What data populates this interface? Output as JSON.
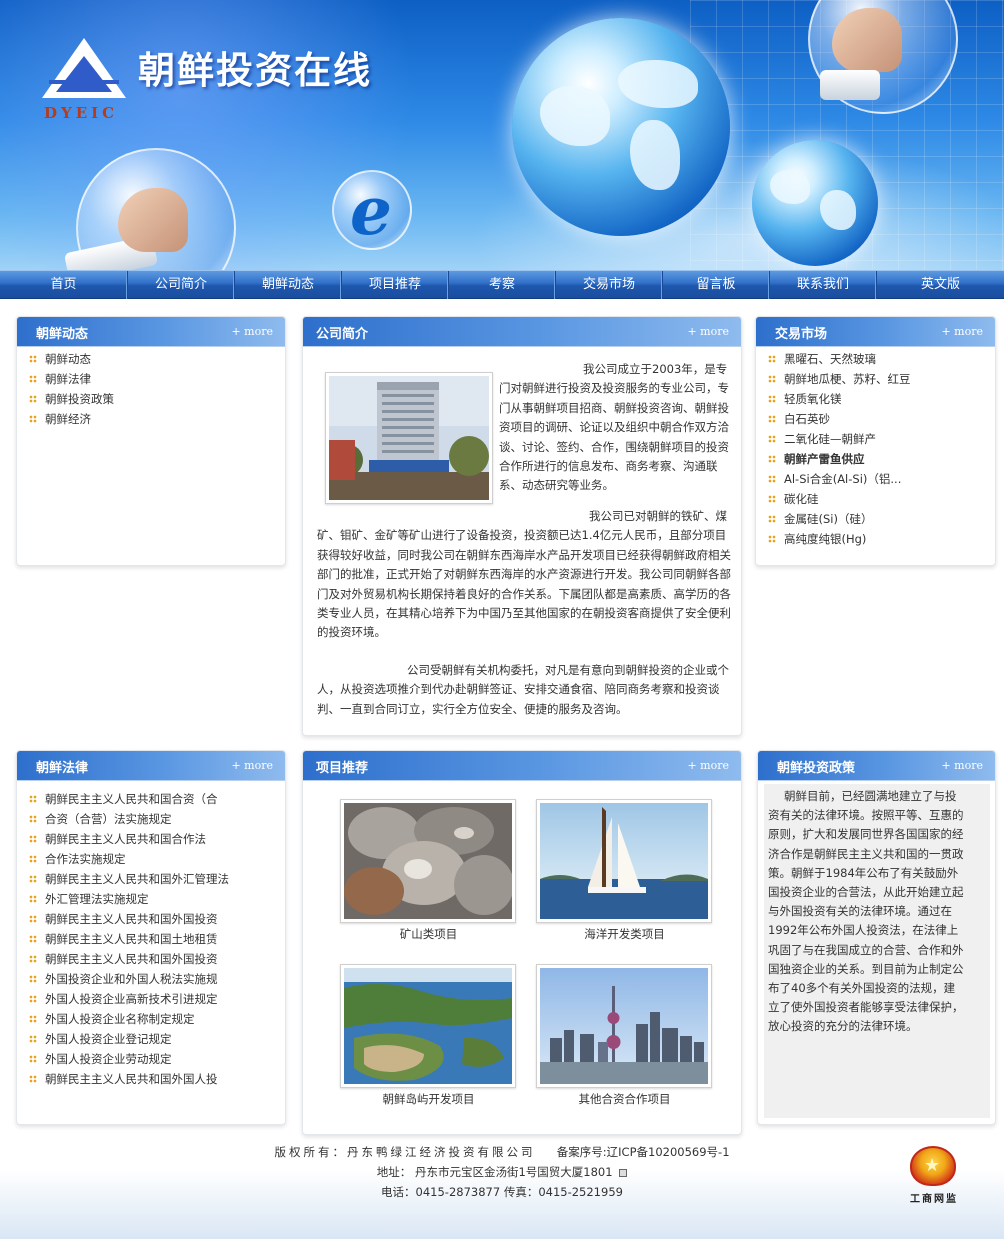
{
  "site": {
    "title": "朝鲜投资在线",
    "logo_abbr": "DYEIC",
    "ie_letter": "e"
  },
  "nav": {
    "items": [
      {
        "label": "首页"
      },
      {
        "label": "公司简介"
      },
      {
        "label": "朝鲜动态"
      },
      {
        "label": "项目推荐"
      },
      {
        "label": "考察"
      },
      {
        "label": "交易市场"
      },
      {
        "label": "留言板"
      },
      {
        "label": "联系我们"
      },
      {
        "label": "英文版"
      }
    ]
  },
  "panels": {
    "dynamics": {
      "title": "朝鲜动态",
      "more": "+ more",
      "items": [
        "朝鲜动态",
        "朝鲜法律",
        "朝鲜投资政策",
        "朝鲜经济"
      ]
    },
    "profile": {
      "title": "公司简介",
      "more": "+ more",
      "para1": "我公司成立于2003年，是专门对朝鲜进行投资及投资服务的专业公司，专门从事朝鲜项目招商、朝鲜投资咨询、朝鲜投资项目的调研、论证以及组织中朝合作双方洽谈、讨论、签约、合作，围绕朝鲜项目的投资合作所进行的信息发布、商务考察、沟通联系、动态研究等业务。",
      "para2": "我公司已对朝鲜的铁矿、煤矿、钼矿、金矿等矿山进行了设备投资，投资额已达1.4亿元人民币，且部分项目获得较好收益，同时我公司在朝鲜东西海岸水产品开发项目已经获得朝鲜政府相关部门的批准，正式开始了对朝鲜东西海岸的水产资源进行开发。我公司同朝鲜各部门及对外贸易机构长期保持着良好的合作关系。下属团队都是高素质、高学历的各类专业人员，在其精心培养下为中国乃至其他国家的在朝投资客商提供了安全便利的投资环境。",
      "para3": "公司受朝鲜有关机构委托，对凡是有意向到朝鲜投资的企业或个人，从投资选项推介到代办赴朝鲜签证、安排交通食宿、陪同商务考察和投资谈判、一直到合同订立，实行全方位安全、便捷的服务及咨询。"
    },
    "market": {
      "title": "交易市场",
      "more": "+ more",
      "items": [
        {
          "label": "黑曜石、天然玻璃",
          "bold": false
        },
        {
          "label": "朝鲜地瓜梗、苏籽、红豆",
          "bold": false
        },
        {
          "label": "轻质氧化镁",
          "bold": false
        },
        {
          "label": "白石英砂",
          "bold": false
        },
        {
          "label": "二氧化硅—朝鲜产",
          "bold": false
        },
        {
          "label": "朝鲜产雷鱼供应",
          "bold": true
        },
        {
          "label": "Al-Si合金(Al-Si)（铝...",
          "bold": false
        },
        {
          "label": "碳化硅",
          "bold": false
        },
        {
          "label": "金属硅(Si)（硅）",
          "bold": false
        },
        {
          "label": "高纯度纯银(Hg)",
          "bold": false
        }
      ]
    },
    "law": {
      "title": "朝鲜法律",
      "more": "+ more",
      "items": [
        "朝鲜民主主义人民共和国合资（合",
        "合资（合营）法实施规定",
        "朝鲜民主主义人民共和国合作法",
        "合作法实施规定",
        "朝鲜民主主义人民共和国外汇管理法",
        "外汇管理法实施规定",
        "朝鲜民主主义人民共和国外国投资",
        "朝鲜民主主义人民共和国土地租赁",
        "朝鲜民主主义人民共和国外国投资",
        "外国投资企业和外国人税法实施规",
        "外国人投资企业高新技术引进规定",
        "外国人投资企业名称制定规定",
        "外国人投资企业登记规定",
        "外国人投资企业劳动规定",
        "朝鲜民主主义人民共和国外国人投"
      ]
    },
    "projects": {
      "title": "项目推荐",
      "more": "+ more",
      "items": [
        {
          "caption": "矿山类项目"
        },
        {
          "caption": "海洋开发类项目"
        },
        {
          "caption": "朝鲜岛屿开发项目"
        },
        {
          "caption": "其他合资合作项目"
        }
      ]
    },
    "policy": {
      "title": "朝鲜投资政策",
      "more": "+ more",
      "text": "朝鲜目前，已经圆满地建立了与投资有关的法律环境。按照平等、互惠的原则，扩大和发展同世界各国国家的经济合作是朝鲜民主主义共和国的一贯政策。朝鲜于1984年公布了有关鼓励外国投资企业的合营法，从此开始建立起与外国投资有关的法律环境。通过在1992年公布外国人投资法，在法律上巩固了与在我国成立的合营、合作和外国独资企业的关系。到目前为止制定公布了40多个有关外国投资的法规，建立了使外国投资者能够享受法律保护，放心投资的充分的法律环境。"
    }
  },
  "footer": {
    "copyright": "版权所有：丹东鸭绿江经济投资有限公司",
    "icp": "备案序号:辽ICP备10200569号-1",
    "address": "地址：  丹东市元宝区金汤街1号国贸大厦1801",
    "phone": "电话：0415-2873877 传真：0415-2521959",
    "badge_text": "工商网监"
  },
  "colors": {
    "banner": "#1e73d6",
    "nav": "#2a66c2",
    "panel_header": "#4a86d8",
    "bullet": "#e8a21c"
  }
}
